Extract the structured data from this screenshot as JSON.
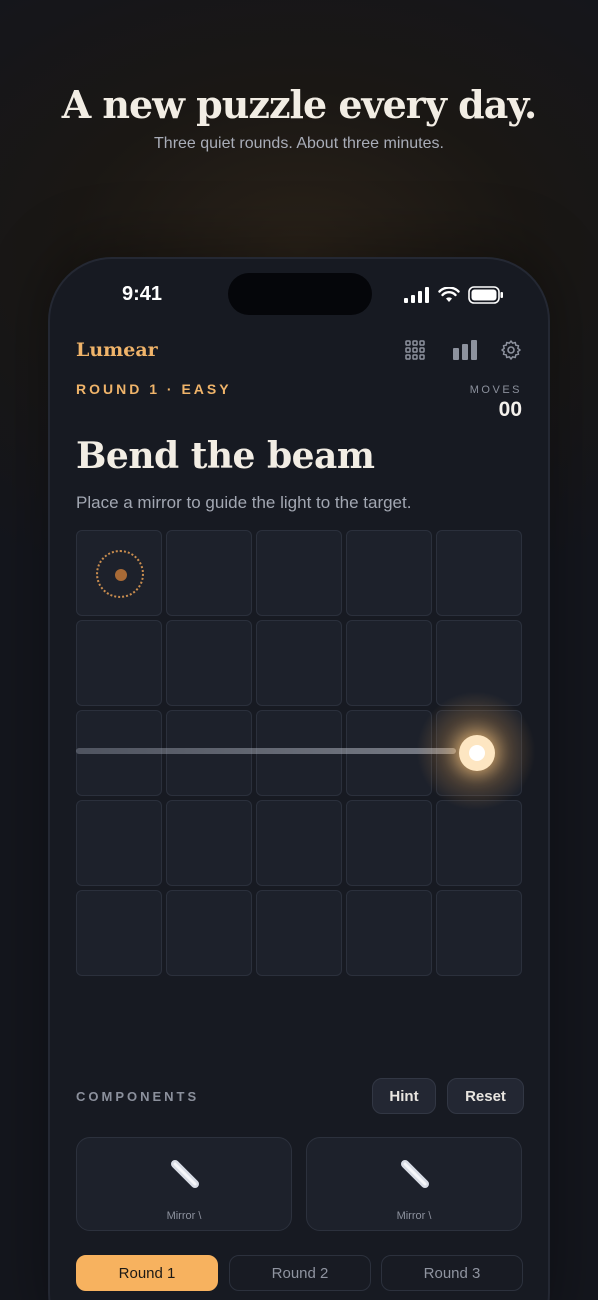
{
  "hero": {
    "title": "A new puzzle every day.",
    "subtitle": "Three quiet rounds. About three minutes."
  },
  "status_bar": {
    "time": "9:41",
    "icons": [
      "signal-icon",
      "wifi-icon",
      "battery-icon"
    ]
  },
  "app": {
    "brand": "Lumear",
    "top_icons": [
      "grid-icon",
      "stats-icon",
      "gear-icon"
    ],
    "round_label": "ROUND 1 · EASY",
    "moves_label": "MOVES",
    "moves_value": "00",
    "puzzle_title": "Bend the beam",
    "puzzle_subtitle": "Place a mirror to guide the light to the target."
  },
  "board": {
    "rows": 5,
    "cols": 5,
    "target": {
      "row": 1,
      "col": 1
    },
    "emitter": {
      "row": 3,
      "col": 5
    },
    "beam_direction": "left"
  },
  "components": {
    "label": "COMPONENTS",
    "hint_label": "Hint",
    "reset_label": "Reset",
    "items": [
      {
        "name": "Mirror \\",
        "icon": "mirror-icon"
      },
      {
        "name": "Mirror \\",
        "icon": "mirror-icon"
      }
    ]
  },
  "rounds": [
    {
      "label": "Round 1",
      "active": true
    },
    {
      "label": "Round 2",
      "active": false
    },
    {
      "label": "Round 3",
      "active": false
    }
  ],
  "colors": {
    "accent": "#f7b25f",
    "brand": "#f0b46a",
    "background": "#14161d",
    "cell": "#1d212b"
  }
}
